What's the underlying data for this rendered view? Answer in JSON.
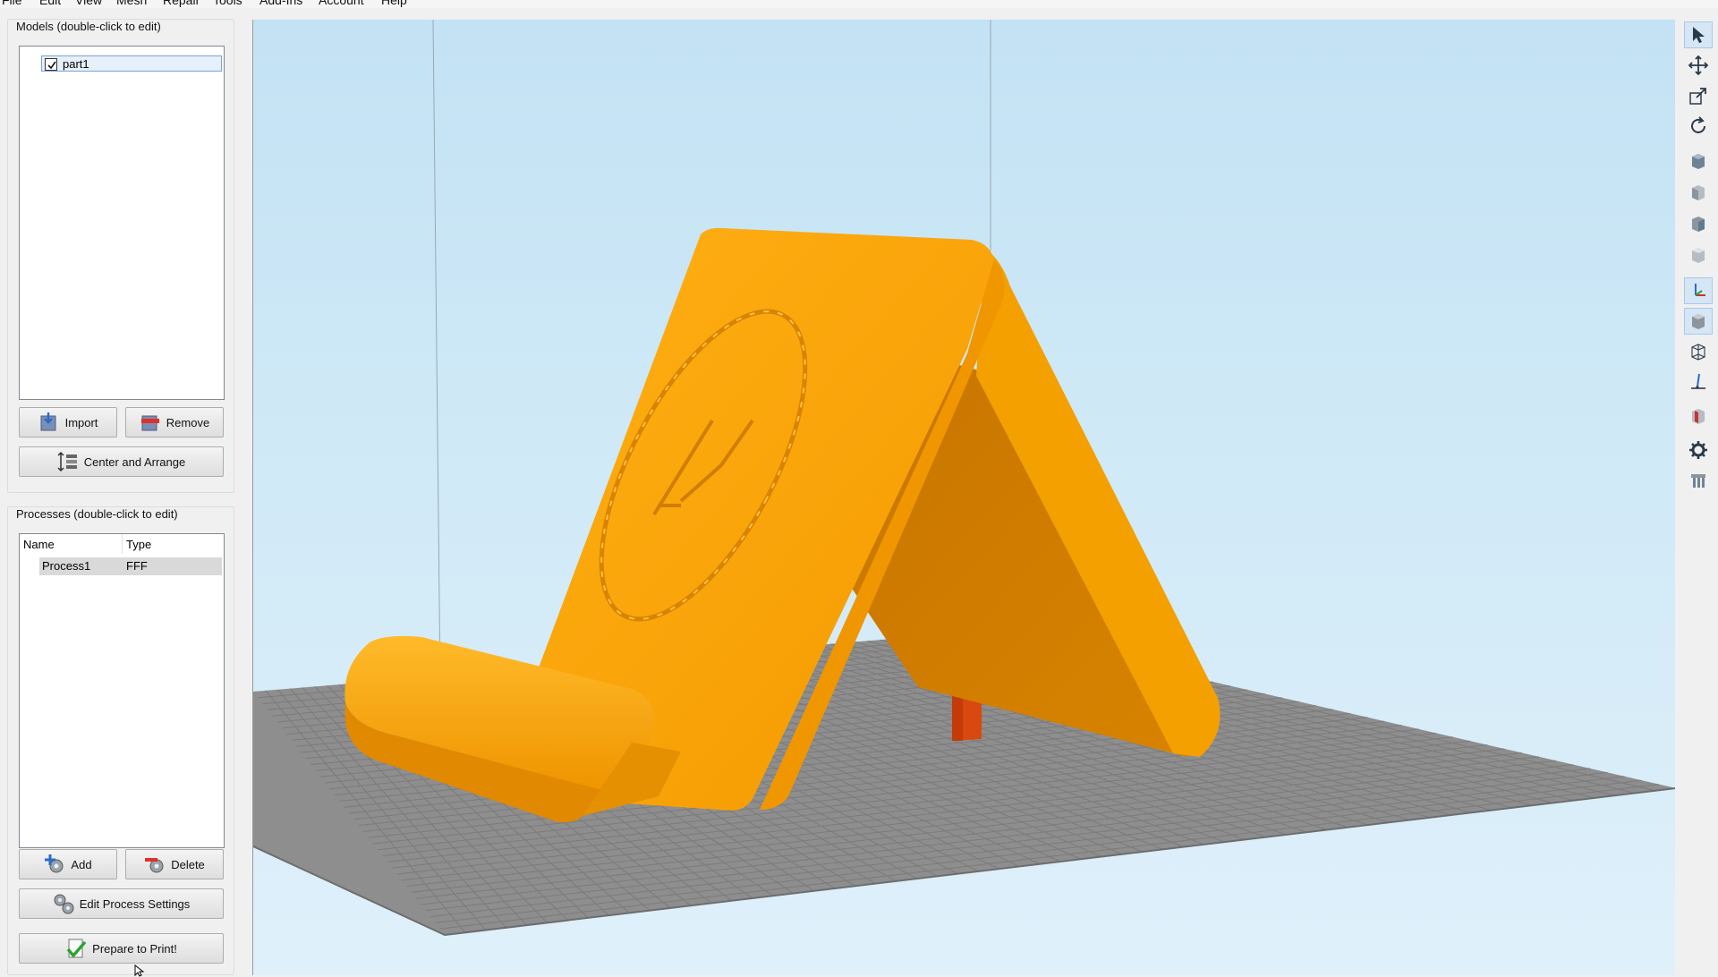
{
  "menu": {
    "items": [
      "File",
      "Edit",
      "View",
      "Mesh",
      "Repair",
      "Tools",
      "Add-Ins",
      "Account",
      "Help"
    ]
  },
  "models": {
    "title": "Models (double-click to edit)",
    "items": [
      {
        "label": "part1",
        "checked": true
      }
    ],
    "import_label": "Import",
    "remove_label": "Remove",
    "center_arrange_label": "Center and Arrange"
  },
  "processes": {
    "title": "Processes (double-click to edit)",
    "columns": [
      "Name",
      "Type"
    ],
    "rows": [
      {
        "name": "Process1",
        "type": "FFF"
      }
    ],
    "add_label": "Add",
    "delete_label": "Delete",
    "edit_settings_label": "Edit Process Settings",
    "prepare_label": "Prepare to Print!"
  },
  "toolbar": {
    "icons": [
      "select-icon",
      "move-icon",
      "scale-icon",
      "rotate-icon",
      "view-iso-icon",
      "view-front-icon",
      "view-side-icon",
      "view-back-icon",
      "axis-icon",
      "solid-icon",
      "wireframe-icon",
      "ruler-icon",
      "cross-section-icon",
      "settings-gear-icon",
      "support-icon"
    ]
  },
  "colors": {
    "model": "#f6a500",
    "model_shadow": "#c97800",
    "support": "#d9480f",
    "bed": "#8c8c8c",
    "sky": "#c6e4f5"
  }
}
